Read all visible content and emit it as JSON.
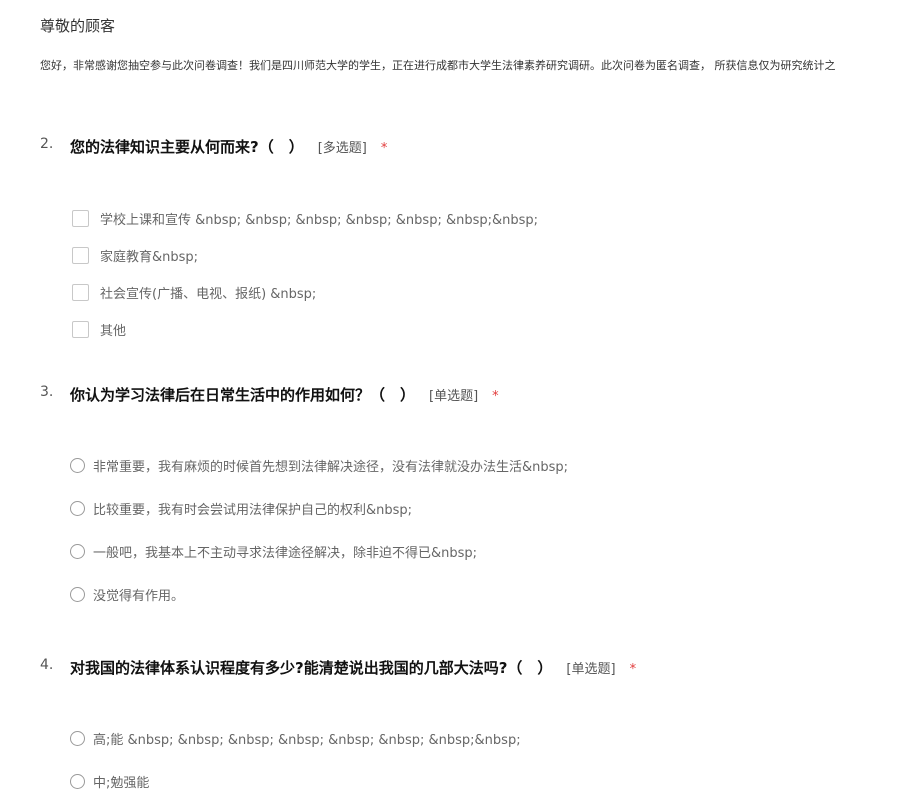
{
  "header": {
    "greeting": "尊敬的顾客",
    "intro": "您好，非常感谢您抽空参与此次问卷调查！我们是四川师范大学的学生，正在进行成都市大学生法律素养研究调研。此次问卷为匿名调查， 所获信息仅为研究统计之"
  },
  "questions": [
    {
      "number": "2.",
      "title": "您的法律知识主要从何而来?（　）",
      "type": "[多选题]",
      "required": "*",
      "options": [
        "学校上课和宣传 &nbsp; &nbsp; &nbsp; &nbsp; &nbsp; &nbsp;&nbsp;",
        "家庭教育&nbsp;",
        "社会宣传(广播、电视、报纸) &nbsp;",
        "其他"
      ]
    },
    {
      "number": "3.",
      "title": "你认为学习法律后在日常生活中的作用如何？（　）",
      "type": "[单选题]",
      "required": "*",
      "options": [
        "非常重要，我有麻烦的时候首先想到法律解决途径，没有法律就没办法生活&nbsp;",
        "比较重要，我有时会尝试用法律保护自己的权利&nbsp;",
        "一般吧，我基本上不主动寻求法律途径解决，除非迫不得已&nbsp;",
        "没觉得有作用。"
      ]
    },
    {
      "number": "4.",
      "title": "对我国的法律体系认识程度有多少?能清楚说出我国的几部大法吗?（　）",
      "type": "[单选题]",
      "required": "*",
      "options": [
        "高;能 &nbsp; &nbsp; &nbsp; &nbsp; &nbsp; &nbsp; &nbsp;&nbsp;",
        "中;勉强能"
      ]
    }
  ]
}
